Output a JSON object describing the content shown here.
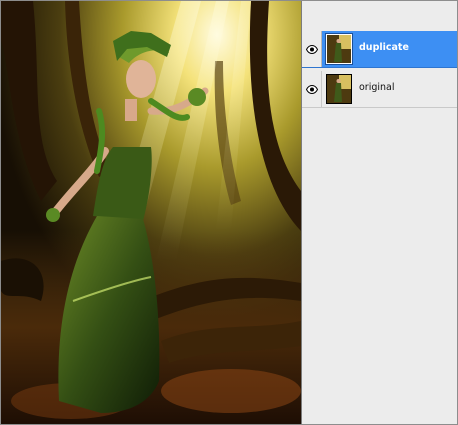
{
  "canvas": {
    "image_label": "Forest fairy photo"
  },
  "layers_panel": {
    "layers": [
      {
        "name": "duplicate",
        "visible": true,
        "selected": true,
        "visibility_icon": "eye-icon"
      },
      {
        "name": "original",
        "visible": true,
        "selected": false,
        "visibility_icon": "eye-icon"
      }
    ]
  },
  "colors": {
    "selection": "#3d8ff3",
    "panel_bg": "#ececec"
  }
}
